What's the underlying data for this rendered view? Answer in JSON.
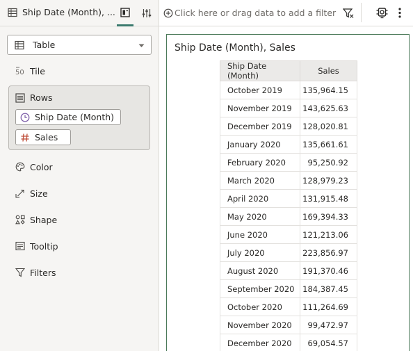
{
  "left_panel": {
    "viz_title": "Ship Date (Month), ...",
    "viz_type": "Table",
    "tile_label": "Tile",
    "rows_label": "Rows",
    "rows_items": [
      {
        "label": "Ship Date (Month)",
        "icon": "clock-icon"
      },
      {
        "label": "Sales",
        "icon": "hash-icon"
      }
    ],
    "color_label": "Color",
    "size_label": "Size",
    "shape_label": "Shape",
    "tooltip_label": "Tooltip",
    "filters_label": "Filters"
  },
  "filter_bar": {
    "placeholder": "Click here or drag data to add a filter"
  },
  "canvas": {
    "title": "Ship Date (Month), Sales",
    "table": {
      "headers": [
        "Ship Date (Month)",
        "Sales"
      ],
      "rows": [
        [
          "October 2019",
          "135,964.15"
        ],
        [
          "November 2019",
          "143,625.63"
        ],
        [
          "December 2019",
          "128,020.81"
        ],
        [
          "January 2020",
          "135,661.61"
        ],
        [
          "February 2020",
          "95,250.92"
        ],
        [
          "March 2020",
          "128,979.23"
        ],
        [
          "April 2020",
          "131,915.48"
        ],
        [
          "May 2020",
          "169,394.33"
        ],
        [
          "June 2020",
          "121,213.06"
        ],
        [
          "July 2020",
          "223,856.97"
        ],
        [
          "August 2020",
          "191,370.46"
        ],
        [
          "September 2020",
          "184,387.45"
        ],
        [
          "October 2020",
          "111,264.69"
        ],
        [
          "November 2020",
          "99,472.97"
        ],
        [
          "December 2020",
          "69,054.57"
        ]
      ]
    }
  },
  "colors": {
    "accent": "#3b7a6e",
    "canvas_border": "#4c7a5a",
    "hash_icon": "#c0503c",
    "clock_icon": "#7a5aa6"
  }
}
